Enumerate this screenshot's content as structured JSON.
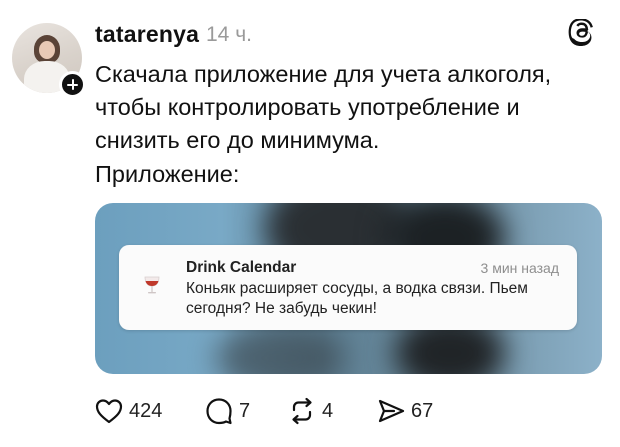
{
  "post": {
    "username": "tatarenya",
    "time": "14 ч.",
    "text_lines": [
      "Скачала приложение для учета алкоголя,",
      "чтобы контролировать употребление и",
      "снизить его до минимума."
    ],
    "caption": "Приложение:"
  },
  "notification": {
    "app_name": "Drink Calendar",
    "time": "3 мин назад",
    "body": "Коньяк расширяет сосуды, а водка связи. Пьем сегодня? Не забудь чекин!",
    "icon": "wine-glass-icon"
  },
  "actions": {
    "likes": "424",
    "replies": "7",
    "reposts": "4",
    "shares": "67"
  },
  "colors": {
    "text": "#111111",
    "muted": "#9a9a9a",
    "image_bg": "#6c9fbe",
    "wine": "#c0392b"
  }
}
